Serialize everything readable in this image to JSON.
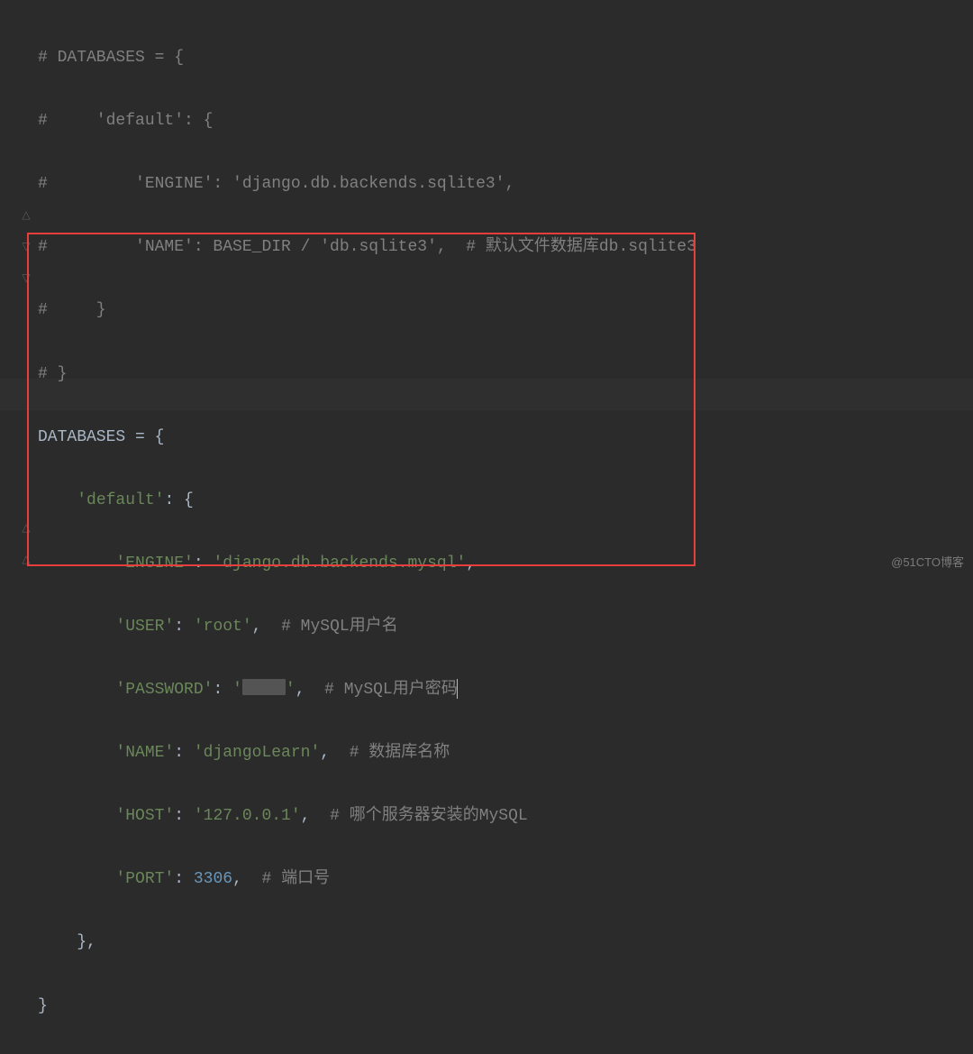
{
  "commented_block": {
    "l1": "# DATABASES = {",
    "l2": "#     'default': {",
    "l3": "#         'ENGINE': 'django.db.backends.sqlite3',",
    "l4_a": "#         'NAME': BASE_DIR / 'db.sqlite3',  ",
    "l4_b": "# 默认文件数据库db.sqlite3",
    "l5": "#     }",
    "l6": "# }"
  },
  "active_block": {
    "db_open": "DATABASES ",
    "equals": "= ",
    "brace_open": "{",
    "default_key": "'default'",
    "colon": ": ",
    "inner_open": "{",
    "engine_key": "'ENGINE'",
    "engine_val": "'django.db.backends.mysql'",
    "user_key": "'USER'",
    "user_val": "'root'",
    "user_comment": "# MySQL用户名",
    "password_key": "'PASSWORD'",
    "password_open": "'",
    "password_close": "'",
    "password_comment": "# MySQL用户密码",
    "name_key": "'NAME'",
    "name_val": "'djangoLearn'",
    "name_comment": "# 数据库名称",
    "host_key": "'HOST'",
    "host_val": "'127.0.0.1'",
    "host_comment": "# 哪个服务器安装的MySQL",
    "port_key": "'PORT'",
    "port_val": "3306",
    "port_comment": "# 端口号",
    "inner_close": "},",
    "outer_close": "}",
    "comma": ",",
    "sep": "  "
  },
  "watermark": "@51CTO博客"
}
